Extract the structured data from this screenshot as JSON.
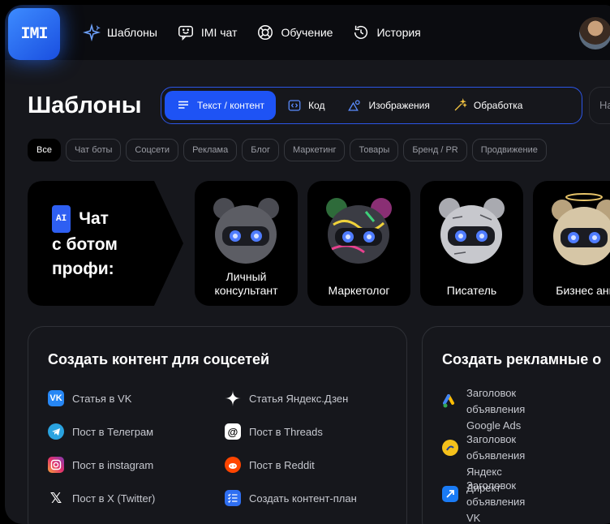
{
  "logo": {
    "text": "IMI"
  },
  "nav": [
    {
      "label": "Шаблоны",
      "icon": "sparkle-icon"
    },
    {
      "label": "IMI чат",
      "icon": "chat-smile-icon"
    },
    {
      "label": "Обучение",
      "icon": "lifebuoy-icon"
    },
    {
      "label": "История",
      "icon": "history-icon"
    }
  ],
  "page": {
    "title": "Шаблоны"
  },
  "categories": [
    {
      "label": "Текст / контент",
      "icon": "text-lines-icon",
      "active": true
    },
    {
      "label": "Код",
      "icon": "code-icon",
      "active": false
    },
    {
      "label": "Изображения",
      "icon": "image-shapes-icon",
      "active": false
    },
    {
      "label": "Обработка",
      "icon": "magic-wand-icon",
      "active": false
    }
  ],
  "search": {
    "placeholder": "На"
  },
  "filters": [
    "Все",
    "Чат боты",
    "Соцсети",
    "Реклама",
    "Блог",
    "Маркетинг",
    "Товары",
    "Бренд / PR",
    "Продвижение"
  ],
  "promo": {
    "badge": "AI",
    "line1": "Чат",
    "line2": "с ботом",
    "line3": "профи:"
  },
  "bots": [
    {
      "label": "Личный консультант"
    },
    {
      "label": "Маркетолог"
    },
    {
      "label": "Писатель"
    },
    {
      "label": "Бизнес анг"
    }
  ],
  "card_social": {
    "title": "Создать контент для соцсетей",
    "items": [
      {
        "label": "Статья в VK",
        "icon": "vk-icon"
      },
      {
        "label": "Статья Яндекс.Дзен",
        "icon": "dzen-icon"
      },
      {
        "label": "Пост в Телеграм",
        "icon": "telegram-icon"
      },
      {
        "label": "Пост в Threads",
        "icon": "threads-icon"
      },
      {
        "label": "Пост в instagram",
        "icon": "instagram-icon"
      },
      {
        "label": "Пост в Reddit",
        "icon": "reddit-icon"
      },
      {
        "label": "Пост в X (Twitter)",
        "icon": "x-icon"
      },
      {
        "label": "Создать контент-план",
        "icon": "checklist-icon"
      }
    ]
  },
  "card_ads": {
    "title": "Создать рекламные о",
    "items": [
      {
        "line1": "Заголовок объявления",
        "line2": "Google Ads",
        "icon": "google-ads-icon"
      },
      {
        "line1": "Заголовок объявления",
        "line2": "Яндекс Директ",
        "icon": "yandex-direct-icon"
      },
      {
        "line1": "Заголовок объявления",
        "line2": "VK Реклама",
        "icon": "vk-ads-icon"
      }
    ]
  },
  "colors": {
    "accent": "#1e53f5",
    "background": "#16171c",
    "topbar": "#0b0c10"
  }
}
